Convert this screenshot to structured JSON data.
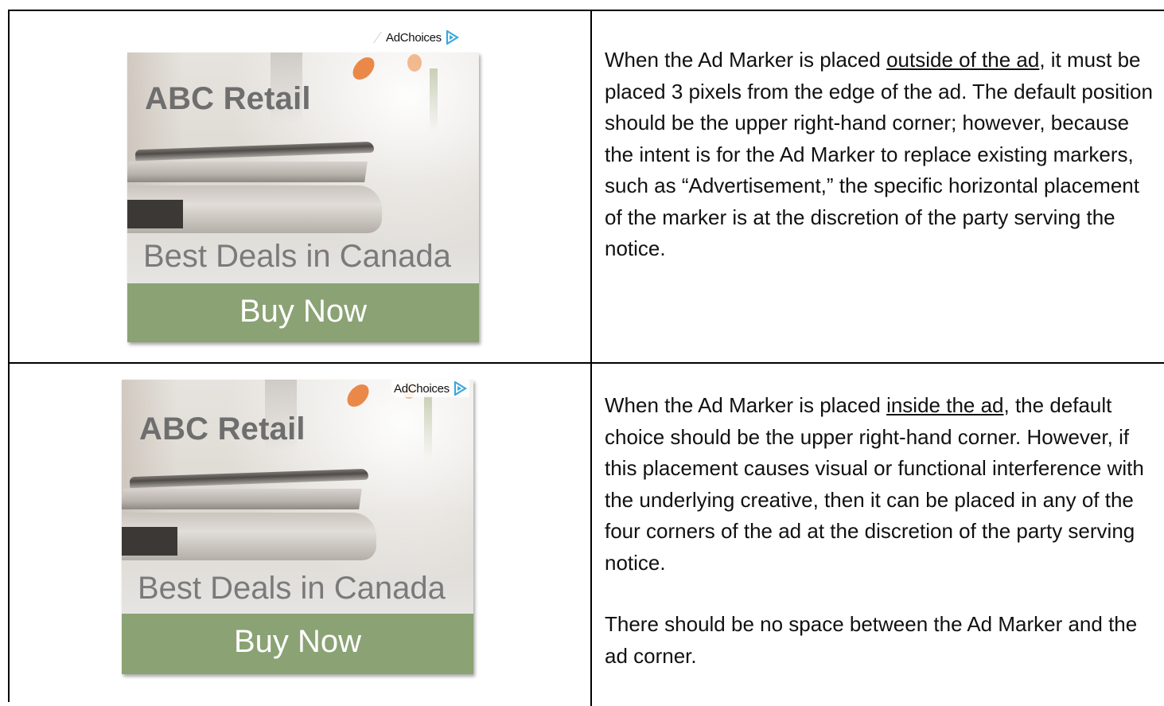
{
  "rows": [
    {
      "ad": {
        "title": "ABC Retail",
        "subtitle": "Best Deals in Canada",
        "cta": "Buy Now",
        "marker": "AdChoices",
        "marker_icon": "adchoices-triangle-icon",
        "cta_color": "#8ba274",
        "marker_color": "#3aa7e0"
      },
      "text": {
        "pre": "When the Ad Marker is placed ",
        "underlined": "outside of the ad",
        "post": ", it must be placed 3 pixels from the edge of the ad. The default position should be the upper right-hand corner; however, because the intent is for the Ad Marker to replace existing markers, such as “Advertisement,” the specific horizontal placement of the marker is at the discretion of the party serving the notice."
      }
    },
    {
      "ad": {
        "title": "ABC Retail",
        "subtitle": "Best Deals in Canada",
        "cta": "Buy Now",
        "marker": "AdChoices",
        "marker_icon": "adchoices-triangle-icon",
        "cta_color": "#8ba274",
        "marker_color": "#3aa7e0"
      },
      "text": {
        "pre": "When the Ad Marker is placed ",
        "underlined": "inside the ad",
        "post": ", the default choice should be the upper right-hand corner. However, if this placement causes visual or functional interference with the underlying creative, then it can be placed in any of the four corners of the ad at the discretion of the party serving notice.",
        "para2": "There should be no space between the Ad Marker and the ad corner."
      }
    }
  ]
}
